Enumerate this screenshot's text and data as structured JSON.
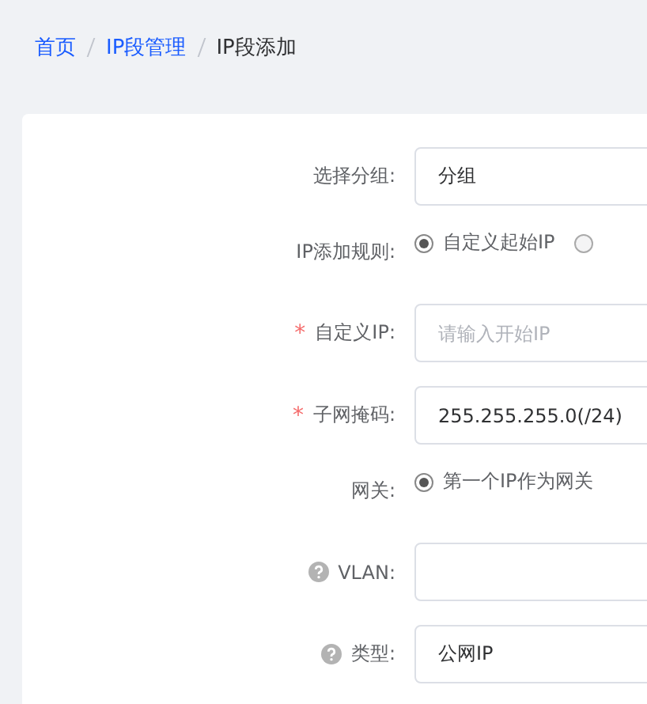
{
  "breadcrumb": [
    {
      "label": "首页",
      "link": true
    },
    {
      "label": "IP段管理",
      "link": true
    },
    {
      "label": "IP段添加",
      "link": false
    }
  ],
  "form": [
    {
      "kind": "select",
      "label": "选择分组:",
      "required": false,
      "help": false,
      "value": "分组"
    },
    {
      "kind": "radio",
      "label": "IP添加规则:",
      "required": false,
      "help": false,
      "options": [
        {
          "label": "自定义起始IP",
          "selected": true
        },
        {
          "selected": false
        }
      ]
    },
    {
      "kind": "input",
      "label": "自定义IP:",
      "required": true,
      "required_mark": "*",
      "help": false,
      "placeholder": "请输入开始IP"
    },
    {
      "kind": "input",
      "label": "子网掩码:",
      "required": true,
      "required_mark": "*",
      "help": false,
      "value": "255.255.255.0(/24)"
    },
    {
      "kind": "radio",
      "label": "网关:",
      "required": false,
      "help": false,
      "options": [
        {
          "label": "第一个IP作为网关",
          "selected": true
        }
      ]
    },
    {
      "kind": "input",
      "label": "VLAN:",
      "required": false,
      "help": true
    },
    {
      "kind": "select",
      "label": "类型:",
      "required": false,
      "help": true,
      "value": "公网IP"
    }
  ]
}
